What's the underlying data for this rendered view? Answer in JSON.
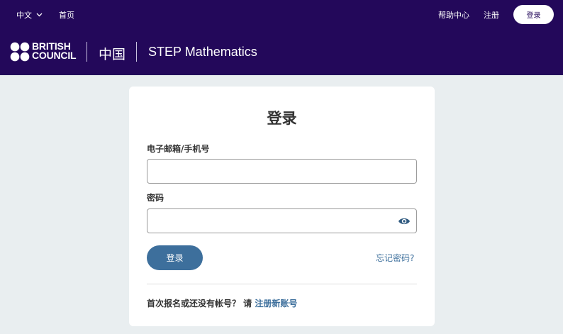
{
  "colors": {
    "header_bg": "#23085a",
    "page_bg": "#e9eef0",
    "accent": "#3d6f9c"
  },
  "topbar": {
    "language": "中文",
    "language_icon": "chevron-down-icon",
    "home": "首页",
    "help": "帮助中心",
    "register": "注册",
    "login": "登录"
  },
  "brand": {
    "logo_line1": "BRITISH",
    "logo_line2": "COUNCIL",
    "country": "中国",
    "product": "STEP Mathematics"
  },
  "login_form": {
    "title": "登录",
    "email_label": "电子邮箱/手机号",
    "email_value": "",
    "password_label": "密码",
    "password_value": "",
    "show_password_icon": "eye-icon",
    "submit_label": "登录",
    "forgot_password": "忘记密码?",
    "signup_prompt": "首次报名或还没有帐号？ 请 ",
    "signup_link": "注册新账号"
  }
}
